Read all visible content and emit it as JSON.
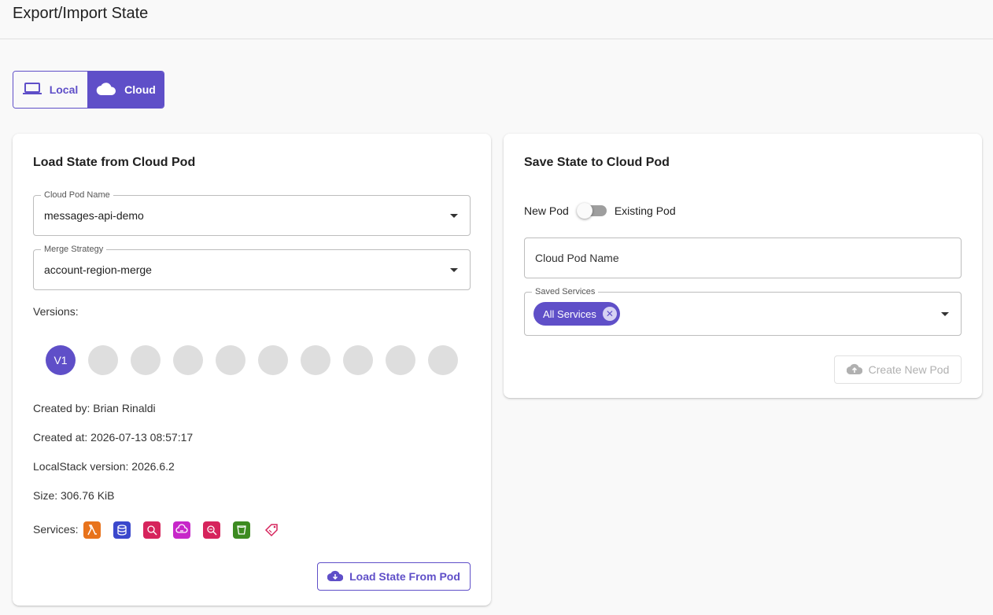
{
  "header": {
    "title": "Export/Import State"
  },
  "mode_toggle": {
    "local_label": "Local",
    "cloud_label": "Cloud",
    "selected": "Cloud"
  },
  "load_card": {
    "title": "Load State from Cloud Pod",
    "pod_name": {
      "label": "Cloud Pod Name",
      "value": "messages-api-demo"
    },
    "merge_strategy": {
      "label": "Merge Strategy",
      "value": "account-region-merge"
    },
    "versions_label": "Versions:",
    "versions": [
      "V1",
      "",
      "",
      "",
      "",
      "",
      "",
      "",
      "",
      ""
    ],
    "selected_version": "V1",
    "created_by": "Created by: Brian Rinaldi",
    "created_at": "Created at: 2026-07-13 08:57:17",
    "localstack_version": "LocalStack version: 2026.6.2",
    "size": "Size: 306.76 KiB",
    "services_label": "Services:",
    "service_icons": [
      {
        "icon": "lambda-icon",
        "color": "#e8731c"
      },
      {
        "icon": "dynamodb-icon",
        "color": "#3b48cc"
      },
      {
        "icon": "cloudwatch-icon",
        "color": "#d6245c"
      },
      {
        "icon": "eventbridge-icon",
        "color": "#c727c9"
      },
      {
        "icon": "cloudwatch-logs-icon",
        "color": "#d6245c"
      },
      {
        "icon": "s3-icon",
        "color": "#3d8b21"
      },
      {
        "icon": "resource-groups-tagging-icon",
        "color": "#d6245c"
      }
    ],
    "load_button": "Load State From Pod"
  },
  "save_card": {
    "title": "Save State to Cloud Pod",
    "switch_left": "New Pod",
    "switch_right": "Existing Pod",
    "pod_name_placeholder": "Cloud Pod Name",
    "saved_services": {
      "label": "Saved Services",
      "chip": "All Services"
    },
    "create_button": "Create New Pod"
  },
  "colors": {
    "accent": "#5f4fc8",
    "version_inactive": "#dedede",
    "disabled": "#b0b0b0"
  }
}
